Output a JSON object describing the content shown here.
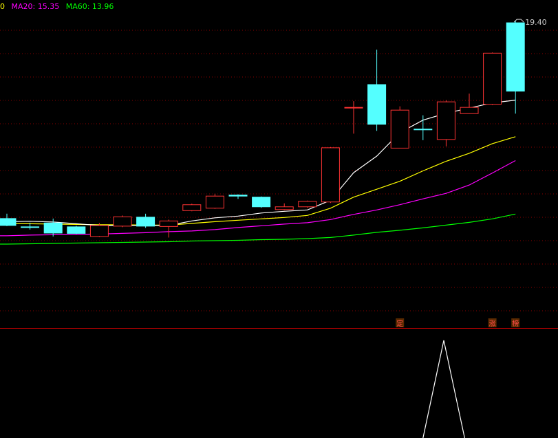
{
  "legend": [
    {
      "text": "0",
      "color": "#ffff00"
    },
    {
      "text": "MA20: 15.35",
      "color": "#ff00ff"
    },
    {
      "text": "MA60: 13.96",
      "color": "#00ff00"
    }
  ],
  "colors": {
    "up": "#ff3333",
    "down": "#54ffff",
    "ma5": "#ffffff",
    "ma10": "#ffff00",
    "ma20": "#ff00ff",
    "ma60": "#00ff00",
    "grid": "#8b0000",
    "separator": "#c00000",
    "indicator": "#ffffff",
    "marker_text": "#ff4b4b",
    "marker_bg": "#5a2a00"
  },
  "chart_data": {
    "type": "candlestick",
    "ylim": [
      10.5,
      20.0
    ],
    "high_label": "19.40",
    "candles": [
      {
        "x": 0,
        "o": 13.67,
        "h": 13.81,
        "l": 13.45,
        "c": 13.47
      },
      {
        "x": 1,
        "o": 13.43,
        "h": 13.55,
        "l": 13.35,
        "c": 13.41
      },
      {
        "x": 2,
        "o": 13.54,
        "h": 13.67,
        "l": 13.15,
        "c": 13.25
      },
      {
        "x": 3,
        "o": 13.43,
        "h": 13.46,
        "l": 13.22,
        "c": 13.24
      },
      {
        "x": 4,
        "o": 13.15,
        "h": 13.54,
        "l": 13.13,
        "c": 13.47
      },
      {
        "x": 5,
        "o": 13.45,
        "h": 13.76,
        "l": 13.42,
        "c": 13.72
      },
      {
        "x": 6,
        "o": 13.71,
        "h": 13.81,
        "l": 13.4,
        "c": 13.45
      },
      {
        "x": 7,
        "o": 13.44,
        "h": 13.64,
        "l": 13.12,
        "c": 13.6
      },
      {
        "x": 8,
        "o": 13.9,
        "h": 14.1,
        "l": 13.88,
        "c": 14.07
      },
      {
        "x": 9,
        "o": 13.97,
        "h": 14.39,
        "l": 13.95,
        "c": 14.32
      },
      {
        "x": 10,
        "o": 14.35,
        "h": 14.37,
        "l": 14.24,
        "c": 14.32
      },
      {
        "x": 11,
        "o": 14.29,
        "h": 14.31,
        "l": 13.98,
        "c": 14.01
      },
      {
        "x": 12,
        "o": 13.93,
        "h": 14.11,
        "l": 13.91,
        "c": 14.01
      },
      {
        "x": 13,
        "o": 14.01,
        "h": 14.19,
        "l": 13.98,
        "c": 14.17
      },
      {
        "x": 14,
        "o": 14.15,
        "h": 15.74,
        "l": 14.12,
        "c": 15.72
      },
      {
        "x": 15,
        "o": 16.89,
        "h": 17.07,
        "l": 16.13,
        "c": 16.89
      },
      {
        "x": 16,
        "o": 17.55,
        "h": 18.56,
        "l": 16.21,
        "c": 16.4
      },
      {
        "x": 17,
        "o": 15.71,
        "h": 16.92,
        "l": 15.71,
        "c": 16.81
      },
      {
        "x": 18,
        "o": 16.26,
        "h": 16.66,
        "l": 15.94,
        "c": 16.25
      },
      {
        "x": 19,
        "o": 15.96,
        "h": 17.1,
        "l": 15.76,
        "c": 17.05
      },
      {
        "x": 20,
        "o": 16.71,
        "h": 17.29,
        "l": 16.71,
        "c": 16.89
      },
      {
        "x": 21,
        "o": 16.98,
        "h": 18.48,
        "l": 16.96,
        "c": 18.46
      },
      {
        "x": 22,
        "o": 19.34,
        "h": 19.4,
        "l": 16.71,
        "c": 17.36
      }
    ],
    "ma5": [
      [
        0,
        13.58
      ],
      [
        1,
        13.59
      ],
      [
        2,
        13.57
      ],
      [
        3,
        13.52
      ],
      [
        4,
        13.47
      ],
      [
        5,
        13.47
      ],
      [
        6,
        13.47
      ],
      [
        7,
        13.47
      ],
      [
        8,
        13.6
      ],
      [
        9,
        13.69
      ],
      [
        10,
        13.74
      ],
      [
        11,
        13.83
      ],
      [
        12,
        13.88
      ],
      [
        13,
        13.92
      ],
      [
        14,
        14.2
      ],
      [
        15,
        15.0
      ],
      [
        16,
        15.48
      ],
      [
        17,
        16.16
      ],
      [
        18,
        16.52
      ],
      [
        19,
        16.72
      ],
      [
        20,
        16.87
      ],
      [
        21,
        17.02
      ],
      [
        22,
        17.1
      ]
    ],
    "ma10": [
      [
        0,
        13.52
      ],
      [
        1,
        13.52
      ],
      [
        2,
        13.51
      ],
      [
        3,
        13.5
      ],
      [
        4,
        13.49
      ],
      [
        5,
        13.49
      ],
      [
        6,
        13.48
      ],
      [
        7,
        13.48
      ],
      [
        8,
        13.53
      ],
      [
        9,
        13.58
      ],
      [
        10,
        13.62
      ],
      [
        11,
        13.66
      ],
      [
        12,
        13.7
      ],
      [
        13,
        13.76
      ],
      [
        14,
        13.97
      ],
      [
        15,
        14.29
      ],
      [
        16,
        14.52
      ],
      [
        17,
        14.75
      ],
      [
        18,
        15.05
      ],
      [
        19,
        15.33
      ],
      [
        20,
        15.56
      ],
      [
        21,
        15.84
      ],
      [
        22,
        16.04
      ]
    ],
    "ma20": [
      [
        0,
        13.17
      ],
      [
        1,
        13.19
      ],
      [
        2,
        13.2
      ],
      [
        3,
        13.21
      ],
      [
        4,
        13.22
      ],
      [
        5,
        13.24
      ],
      [
        6,
        13.26
      ],
      [
        7,
        13.29
      ],
      [
        8,
        13.31
      ],
      [
        9,
        13.35
      ],
      [
        10,
        13.41
      ],
      [
        11,
        13.46
      ],
      [
        12,
        13.51
      ],
      [
        13,
        13.55
      ],
      [
        14,
        13.64
      ],
      [
        15,
        13.79
      ],
      [
        16,
        13.92
      ],
      [
        17,
        14.07
      ],
      [
        18,
        14.24
      ],
      [
        19,
        14.4
      ],
      [
        20,
        14.64
      ],
      [
        21,
        14.99
      ],
      [
        22,
        15.35
      ]
    ],
    "ma60": [
      [
        0,
        12.93
      ],
      [
        1,
        12.94
      ],
      [
        2,
        12.95
      ],
      [
        3,
        12.96
      ],
      [
        4,
        12.97
      ],
      [
        5,
        12.98
      ],
      [
        6,
        12.99
      ],
      [
        7,
        13.0
      ],
      [
        8,
        13.02
      ],
      [
        9,
        13.03
      ],
      [
        10,
        13.04
      ],
      [
        11,
        13.06
      ],
      [
        12,
        13.07
      ],
      [
        13,
        13.09
      ],
      [
        14,
        13.12
      ],
      [
        15,
        13.19
      ],
      [
        16,
        13.27
      ],
      [
        17,
        13.33
      ],
      [
        18,
        13.4
      ],
      [
        19,
        13.48
      ],
      [
        20,
        13.56
      ],
      [
        21,
        13.66
      ],
      [
        22,
        13.8
      ]
    ],
    "markers": [
      {
        "x": 17,
        "text": "定"
      },
      {
        "x": 21,
        "text": "涨"
      },
      {
        "x": 22,
        "text": "榜"
      }
    ],
    "indicator": {
      "ylim": [
        0,
        100
      ],
      "points": [
        [
          18,
          0
        ],
        [
          18.9,
          100
        ],
        [
          19.8,
          0
        ]
      ]
    }
  }
}
